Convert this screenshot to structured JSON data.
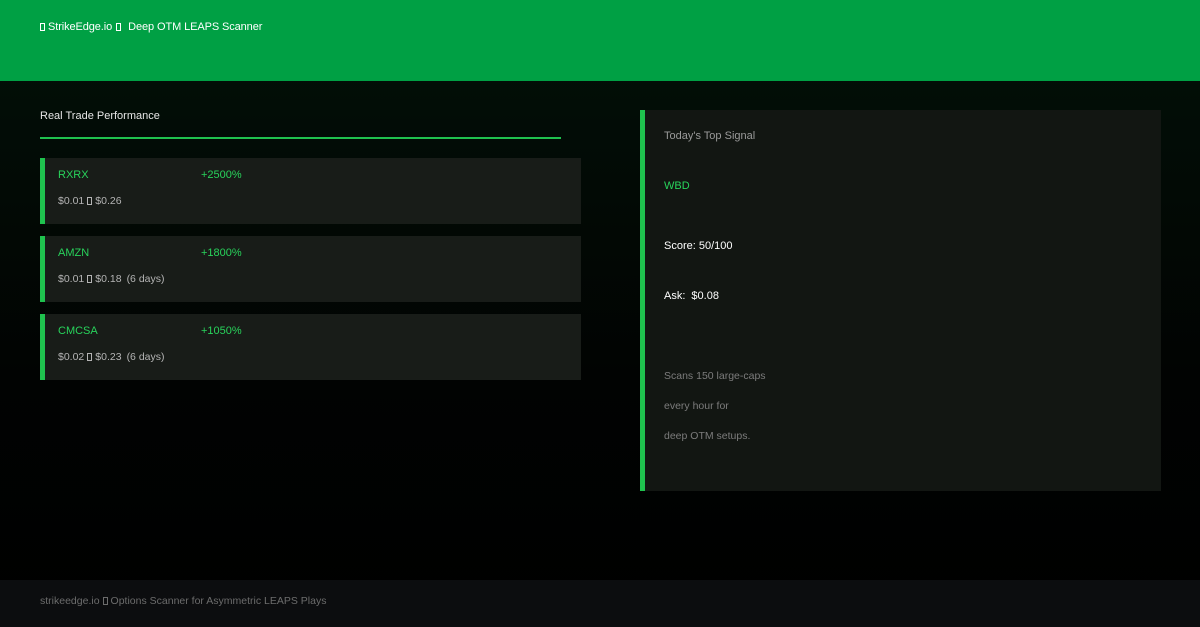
{
  "header": {
    "brand": "StrikeEdge.io",
    "subtitle": "Deep OTM LEAPS Scanner",
    "bg_color": "#00a044"
  },
  "performance": {
    "title": "Real Trade Performance",
    "accent_color": "#1fc24e",
    "trades": [
      {
        "ticker": "RXRX",
        "gain": "+2500%",
        "from": "$0.01",
        "to": "$0.26",
        "duration": ""
      },
      {
        "ticker": "AMZN",
        "gain": "+1800%",
        "from": "$0.01",
        "to": "$0.18",
        "duration": "(6 days)"
      },
      {
        "ticker": "CMCSA",
        "gain": "+1050%",
        "from": "$0.02",
        "to": "$0.23",
        "duration": "(6 days)"
      }
    ]
  },
  "signal": {
    "label": "Today's Top Signal",
    "ticker": "WBD",
    "score": "Score: 50/100",
    "ask_label": "Ask:",
    "ask_value": "$0.08",
    "description": [
      "Scans 150 large-caps",
      "every hour for",
      "deep OTM setups."
    ]
  },
  "footer": {
    "domain": "strikeedge.io",
    "tagline": "Options Scanner for Asymmetric LEAPS Plays"
  }
}
